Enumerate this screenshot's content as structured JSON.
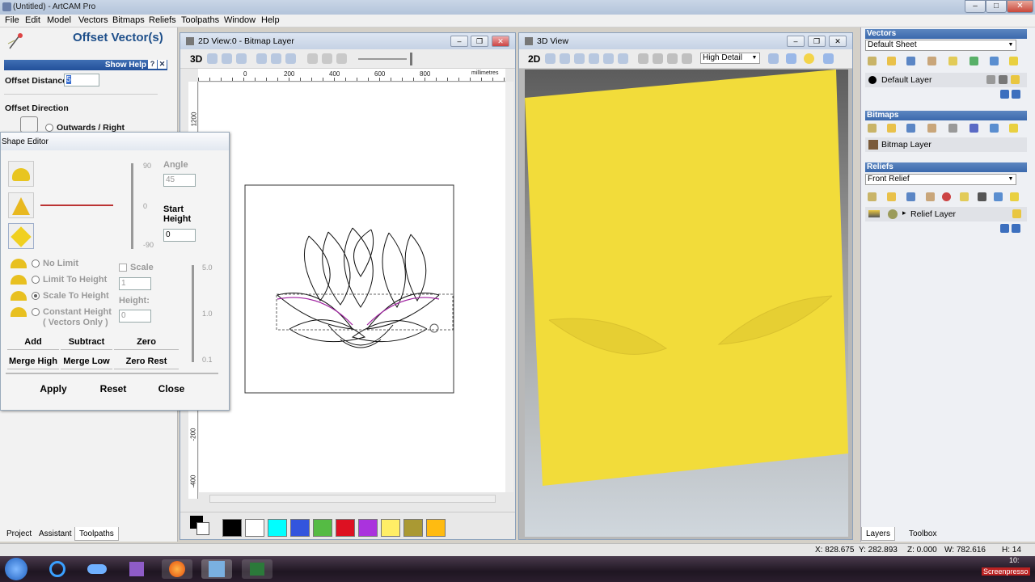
{
  "window": {
    "title": "(Untitled) - ArtCAM Pro",
    "min": "–",
    "max": "□",
    "close": "✕"
  },
  "menu": [
    "File",
    "Edit",
    "Model",
    "Vectors",
    "Bitmaps",
    "Reliefs",
    "Toolpaths",
    "Window",
    "Help"
  ],
  "left_panel": {
    "title": "Offset Vector(s)",
    "show_help": "Show Help",
    "offset_distance_label": "Offset Distance",
    "offset_distance_value": "5",
    "offset_direction_label": "Offset Direction",
    "outwards_label": "Outwards / Right",
    "tabs": [
      "Project",
      "Assistant",
      "Toolpaths"
    ]
  },
  "shape_editor": {
    "title": "Shape Editor",
    "angle_label": "Angle",
    "angle_value": "45",
    "slider_top": "90",
    "slider_mid": "0",
    "slider_bot": "-90",
    "start_height_label_1": "Start",
    "start_height_label_2": "Height",
    "start_height_value": "0",
    "no_limit": "No Limit",
    "limit_to_height": "Limit To Height",
    "scale_to_height": "Scale To Height",
    "constant_height": "Constant Height",
    "vectors_only": "( Vectors Only )",
    "scale_label": "Scale",
    "scale_value": "1",
    "height_label": "Height:",
    "height_value": "0",
    "scale_slider_top": "5.0",
    "scale_slider_mid": "1.0",
    "scale_slider_bot": "0.1",
    "add": "Add",
    "subtract": "Subtract",
    "zero": "Zero",
    "merge_high": "Merge High",
    "merge_low": "Merge Low",
    "zero_rest": "Zero Rest",
    "apply": "Apply",
    "reset": "Reset",
    "close": "Close"
  },
  "view2d": {
    "title": "2D View:0 - Bitmap Layer",
    "mode": "3D",
    "ruler_units": "millimetres",
    "ruler_h": [
      "0",
      "200",
      "400",
      "600",
      "800"
    ],
    "ruler_v": [
      "1200",
      "-200",
      "-400"
    ],
    "palette": [
      "#000000",
      "#ffffff",
      "#00ffff",
      "#3355dd",
      "#55bb44",
      "#dd1122",
      "#aa33dd",
      "#ffee66",
      "#aa9933",
      "#ffbb11"
    ]
  },
  "view3d": {
    "title": "3D View",
    "mode": "2D",
    "detail": "High Detail",
    "relief_color": "#f2dc3a"
  },
  "right_panel": {
    "vectors_header": "Vectors",
    "vectors_sheet": "Default Sheet",
    "vectors_layer": "Default Layer",
    "bitmaps_header": "Bitmaps",
    "bitmaps_layer": "Bitmap Layer",
    "reliefs_header": "Reliefs",
    "reliefs_combo": "Front Relief",
    "reliefs_layer": "Relief Layer",
    "tabs": [
      "Layers",
      "Toolbox"
    ]
  },
  "status": {
    "x": "X: 828.675",
    "y": "Y: 282.893",
    "z": "Z: 0.000",
    "w": "W: 782.616",
    "h": "H: 14"
  },
  "taskbar": {
    "clock": "10:",
    "watermark": "Screenpresso"
  }
}
